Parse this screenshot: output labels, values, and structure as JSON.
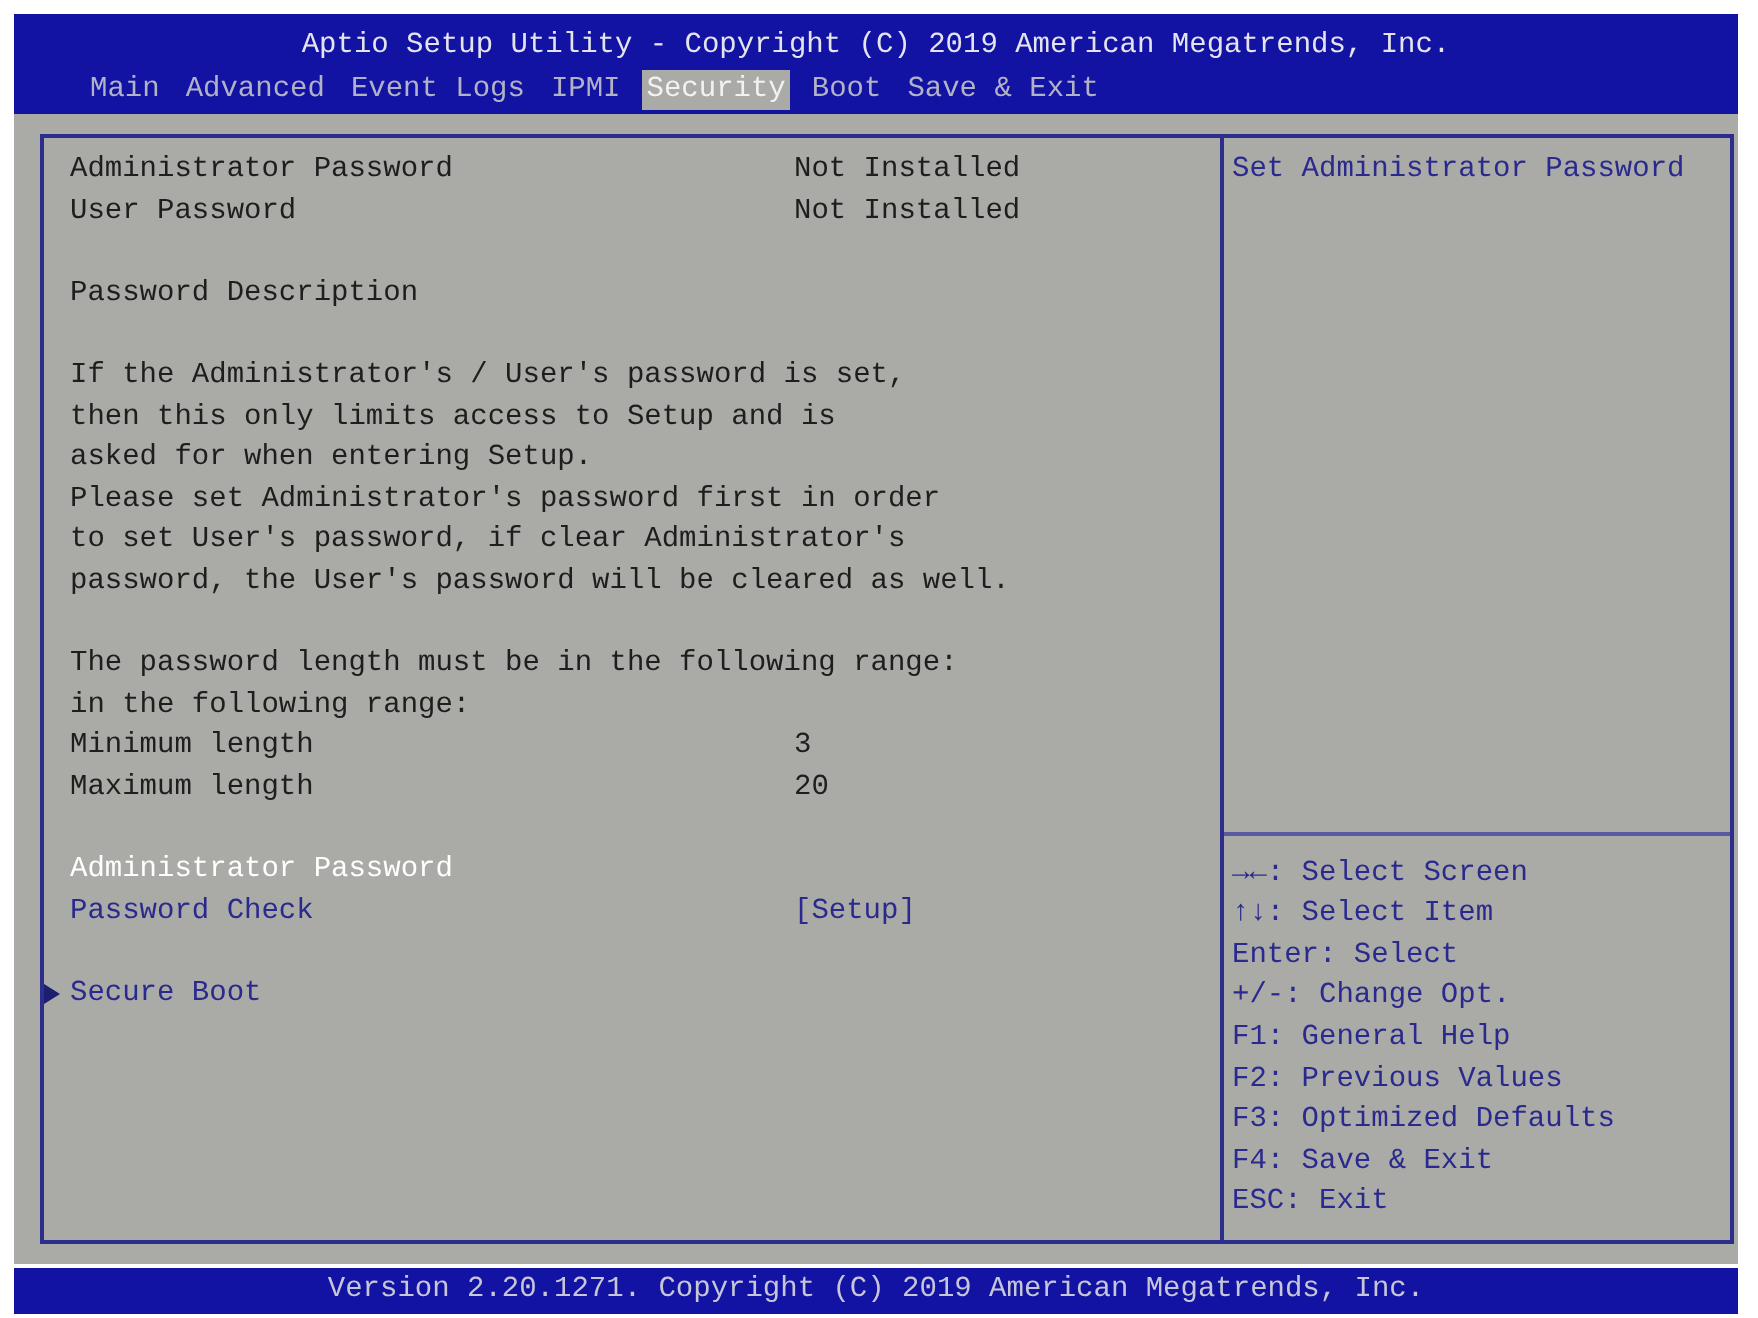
{
  "window": {
    "title": "Aptio Setup Utility - Copyright (C) 2019 American Megatrends, Inc."
  },
  "tabs": [
    {
      "label": "Main",
      "selected": false
    },
    {
      "label": "Advanced",
      "selected": false
    },
    {
      "label": "Event Logs",
      "selected": false
    },
    {
      "label": "IPMI",
      "selected": false
    },
    {
      "label": "Security",
      "selected": true
    },
    {
      "label": "Boot",
      "selected": false
    },
    {
      "label": "Save & Exit",
      "selected": false
    }
  ],
  "sections": [
    {
      "rows": [
        {
          "kind": "info",
          "label": "Administrator Password",
          "value": "Not Installed"
        },
        {
          "kind": "info",
          "label": "User Password",
          "value": "Not Installed"
        }
      ]
    },
    {
      "rows": [
        {
          "kind": "text",
          "text": "Password Description"
        }
      ]
    },
    {
      "rows": [
        {
          "kind": "paragraph",
          "lines": [
            "If the Administrator's / User's password is set,",
            "then this only limits access to Setup and is",
            "asked for when entering Setup.",
            "Please set Administrator's password first in order",
            "to set User's password, if clear Administrator's",
            "password, the User's password will be cleared as well."
          ]
        }
      ]
    },
    {
      "rows": [
        {
          "kind": "paragraph",
          "lines": [
            "The password length must be in the following range:",
            "in the following range:"
          ]
        },
        {
          "kind": "info",
          "label": "Minimum length",
          "value": "3"
        },
        {
          "kind": "info",
          "label": "Maximum length",
          "value": "20"
        }
      ]
    },
    {
      "rows": [
        {
          "kind": "option",
          "label": "Administrator Password",
          "selected": true
        },
        {
          "kind": "option",
          "label": "Password Check",
          "value": "[Setup]",
          "selected": false
        }
      ]
    },
    {
      "rows": [
        {
          "kind": "submenu",
          "label": "Secure Boot",
          "selected": false
        }
      ]
    }
  ],
  "help_text": "Set Administrator Password",
  "key_help": [
    "→←: Select Screen",
    "↑↓: Select Item",
    "Enter: Select",
    "+/-: Change Opt.",
    "F1: General Help",
    "F2: Previous Values",
    "F3: Optimized Defaults",
    "F4: Save & Exit",
    "ESC: Exit"
  ],
  "status_bar": {
    "text": "Version 2.20.1271. Copyright (C) 2019 American Megatrends, Inc."
  }
}
